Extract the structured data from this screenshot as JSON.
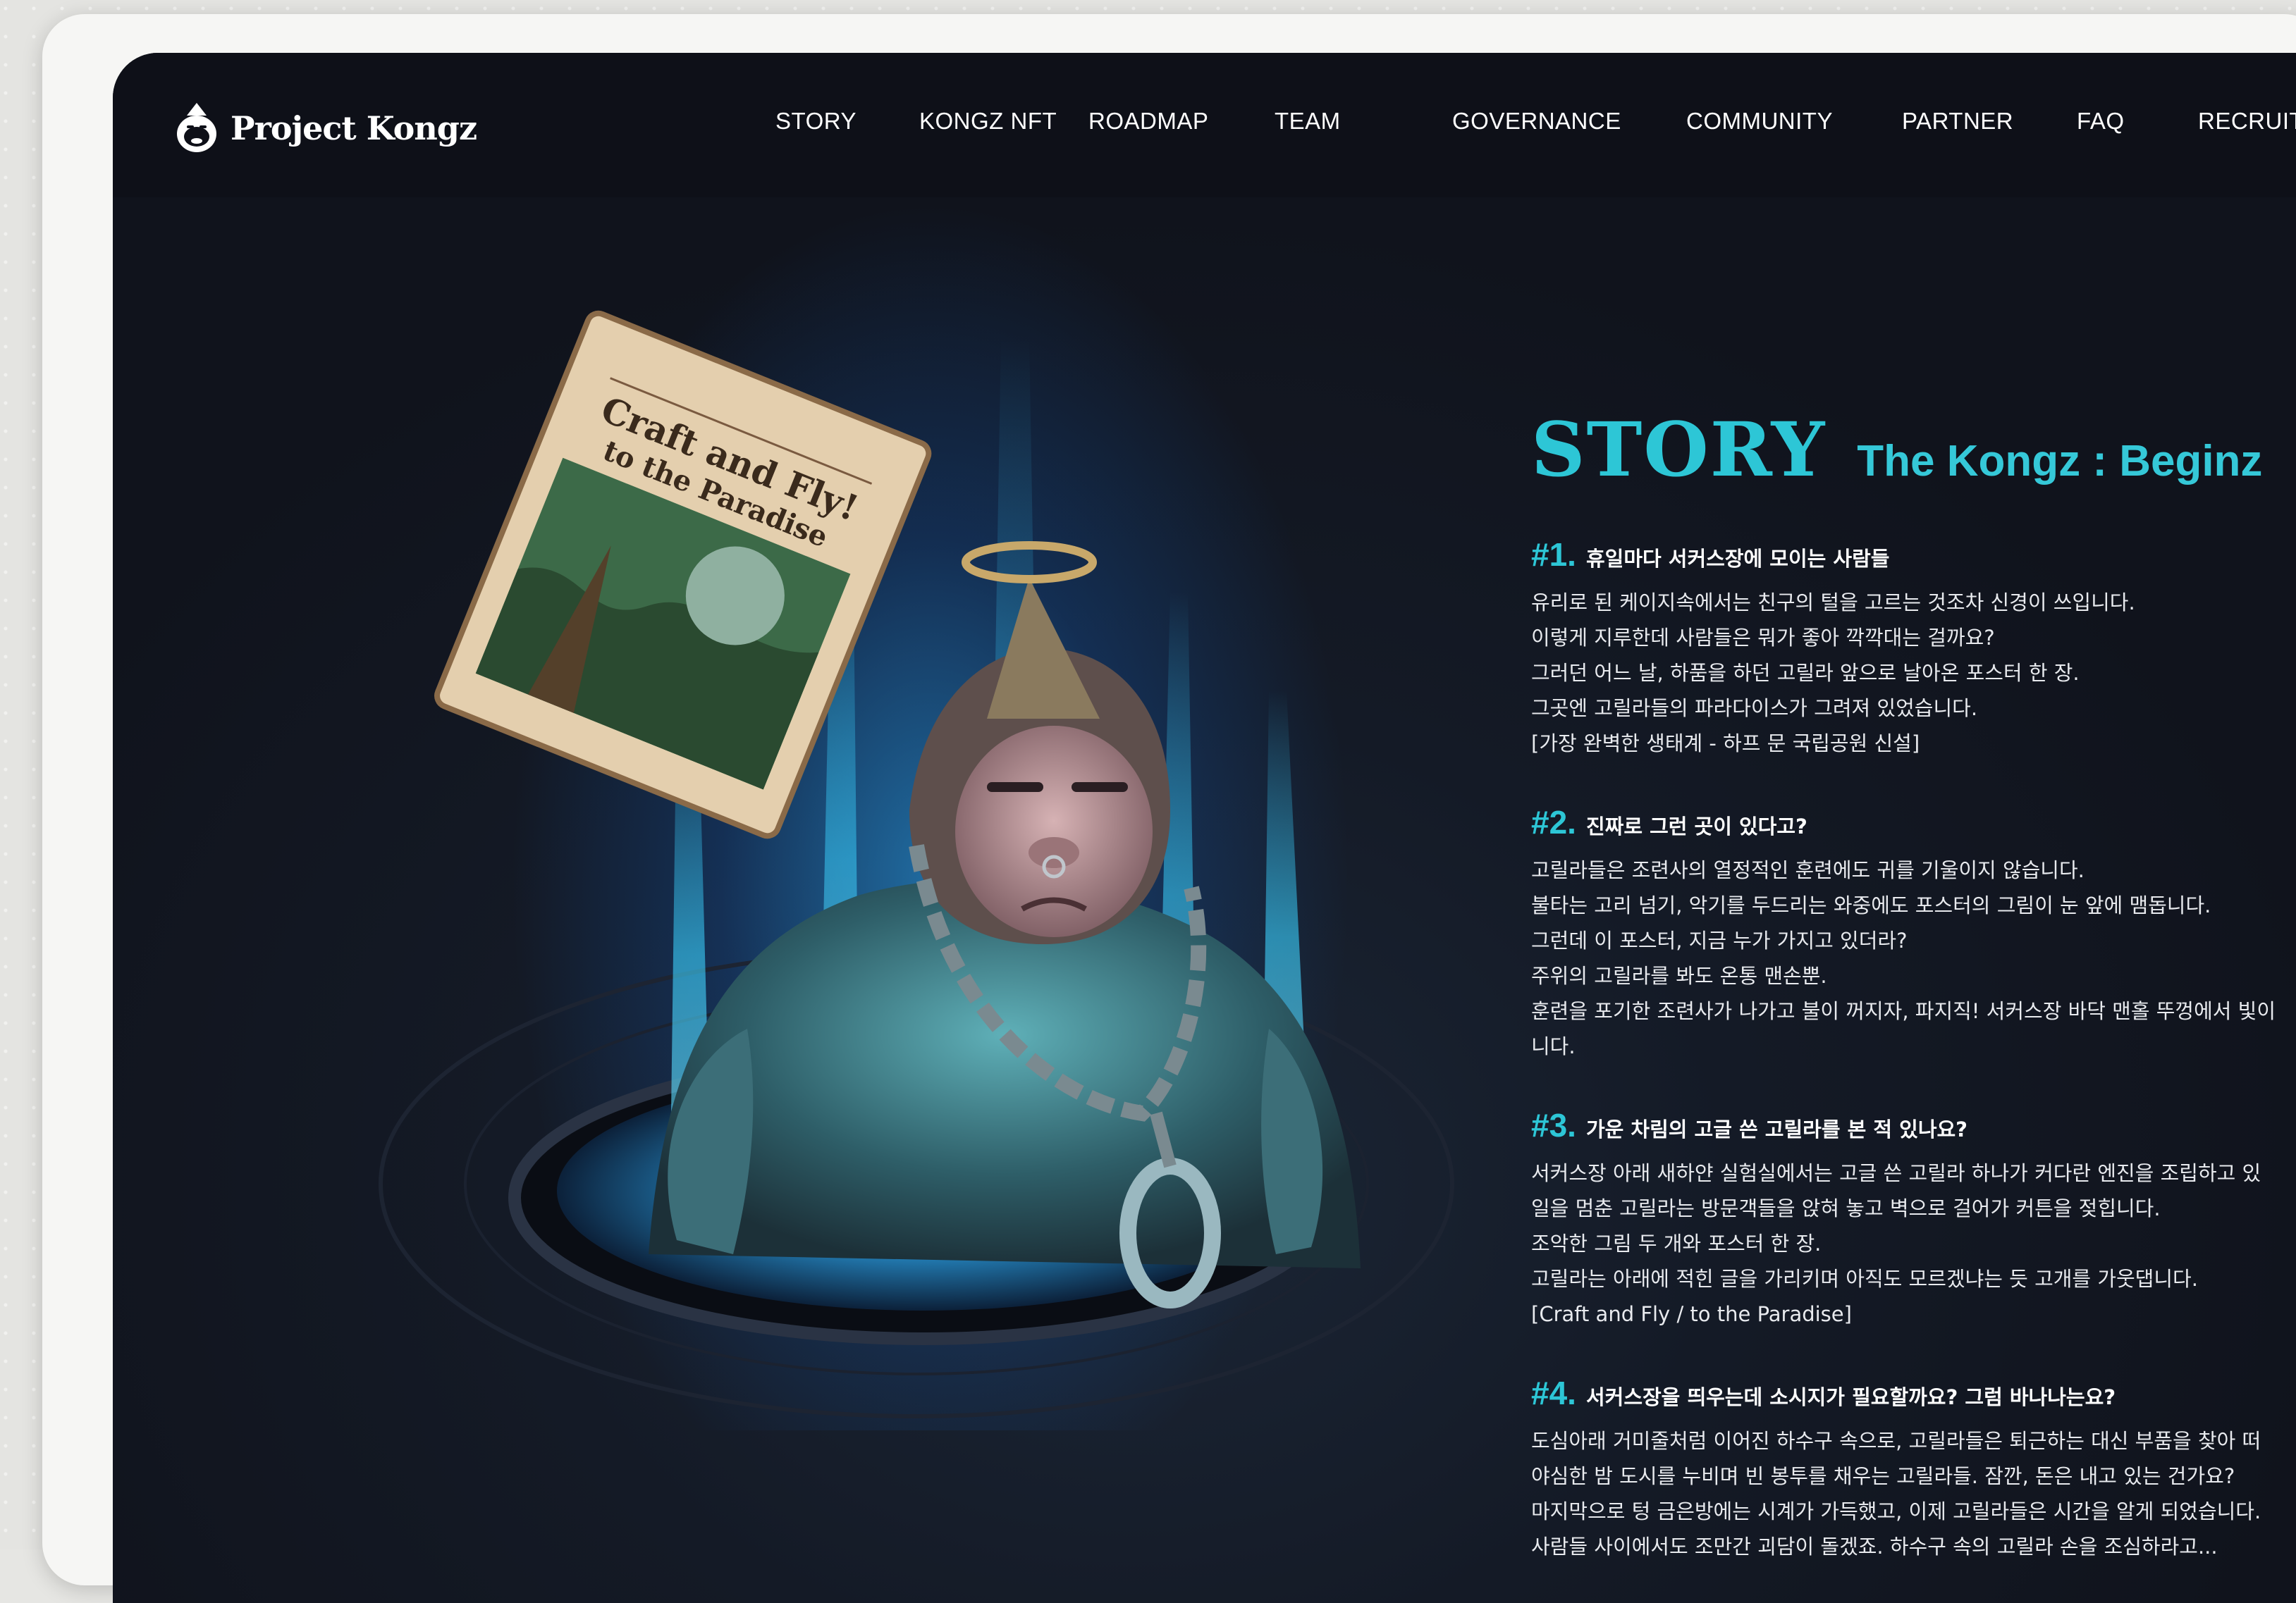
{
  "brand": {
    "name": "Project Kongz"
  },
  "nav": {
    "items": [
      {
        "label": "STORY"
      },
      {
        "label": "KONGZ NFT"
      },
      {
        "label": "ROADMAP"
      },
      {
        "label": "TEAM"
      },
      {
        "label": "GOVERNANCE"
      },
      {
        "label": "COMMUNITY"
      },
      {
        "label": "PARTNER"
      },
      {
        "label": "FAQ"
      },
      {
        "label": "RECRUIT"
      }
    ]
  },
  "poster": {
    "line1": "Craft and Fly!",
    "line2": "to the Paradise"
  },
  "story": {
    "title": "STORY",
    "subtitle": "The Kongz : Beginz",
    "chapters": [
      {
        "num": "#1.",
        "title": "휴일마다 서커스장에 모이는 사람들",
        "lines": [
          "유리로 된 케이지속에서는 친구의 털을 고르는 것조차 신경이 쓰입니다.",
          "이렇게 지루한데 사람들은 뭐가 좋아 깍깍대는 걸까요?",
          "그러던 어느 날, 하품을 하던 고릴라 앞으로 날아온 포스터 한 장.",
          "그곳엔 고릴라들의 파라다이스가 그려져 있었습니다.",
          "[가장 완벽한 생태계 - 하프 문 국립공원 신설]"
        ]
      },
      {
        "num": "#2.",
        "title": "진짜로 그런 곳이 있다고?",
        "lines": [
          "고릴라들은 조련사의 열정적인 훈련에도 귀를 기울이지 않습니다.",
          "불타는 고리 넘기, 악기를 두드리는 와중에도 포스터의 그림이 눈 앞에 맴돕니다.",
          "그런데 이 포스터, 지금 누가 가지고 있더라?",
          "주위의 고릴라를 봐도 온통 맨손뿐.",
          "훈련을 포기한 조련사가 나가고 불이 꺼지자, 파지직! 서커스장 바닥 맨홀 뚜껑에서 빛이",
          "니다."
        ]
      },
      {
        "num": "#3.",
        "title": "가운 차림의 고글 쓴 고릴라를 본 적 있나요?",
        "lines": [
          "서커스장 아래 새하얀 실험실에서는 고글 쓴 고릴라 하나가 커다란 엔진을 조립하고 있",
          "일을 멈춘 고릴라는 방문객들을 앉혀 놓고 벽으로 걸어가 커튼을 젖힙니다.",
          "조악한 그림 두 개와 포스터 한 장.",
          "고릴라는 아래에 적힌 글을 가리키며 아직도 모르겠냐는 듯 고개를 가웃댑니다.",
          "[Craft and Fly / to the Paradise]"
        ]
      },
      {
        "num": "#4.",
        "title": "서커스장을 띄우는데 소시지가 필요할까요? 그럼 바나나는요?",
        "lines": [
          "도심아래 거미줄처럼 이어진 하수구 속으로, 고릴라들은 퇴근하는 대신 부품을 찾아 떠",
          "야심한 밤 도시를 누비며 빈 봉투를 채우는 고릴라들. 잠깐, 돈은 내고 있는 건가요?",
          "마지막으로 텅 금은방에는 시계가 가득했고, 이제 고릴라들은 시간을 알게 되었습니다.",
          "사람들 사이에서도 조만간 괴담이 돌겠죠. 하수구 속의 고릴라 손을 조심하라고..."
        ]
      }
    ]
  },
  "colors": {
    "accent": "#2dc6d6",
    "background": "#11131b",
    "glow": "#28aaff"
  }
}
